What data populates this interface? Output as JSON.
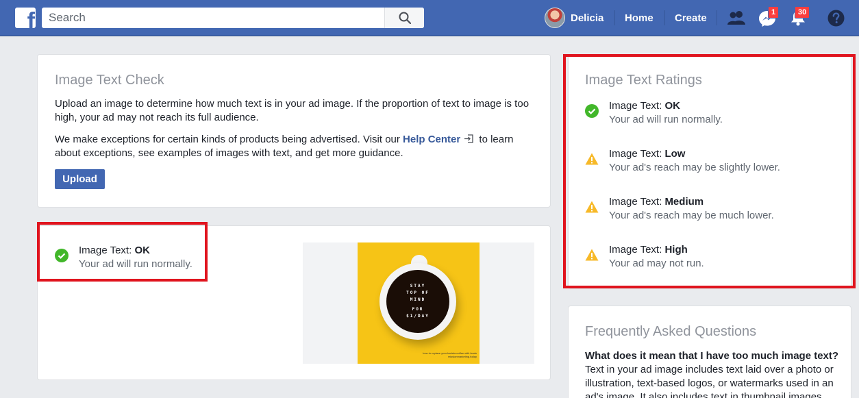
{
  "topbar": {
    "logo": "f",
    "search_placeholder": "Search",
    "user_name": "Delicia",
    "home": "Home",
    "create": "Create",
    "messenger_badge": "1",
    "notifications_badge": "30",
    "brand_color": "#4267b2"
  },
  "check_card": {
    "title": "Image Text Check",
    "para1": "Upload an image to determine how much text is in your ad image. If the proportion of text to image is too high, your ad may not reach its full audience.",
    "para2_before": "We make exceptions for certain kinds of products being advertised. Visit our ",
    "help_link": "Help Center",
    "para2_after": " to learn about exceptions, see examples of images with text, and get more guidance.",
    "upload_label": "Upload"
  },
  "result_card": {
    "label": "Image Text:",
    "value": "OK",
    "desc": "Your ad will run normally.",
    "image": {
      "lines": [
        "STAY",
        "TOP OF",
        "MIND",
        "FOR",
        "$1/DAY"
      ],
      "caption": "how to replace your barista coffee with leads missionmarketing.today"
    }
  },
  "ratings_card": {
    "title": "Image Text Ratings",
    "items": [
      {
        "label": "Image Text:",
        "level": "OK",
        "desc": "Your ad will run normally.",
        "icon": "check-icon"
      },
      {
        "label": "Image Text:",
        "level": "Low",
        "desc": "Your ad's reach may be slightly lower.",
        "icon": "warning-icon"
      },
      {
        "label": "Image Text:",
        "level": "Medium",
        "desc": "Your ad's reach may be much lower.",
        "icon": "warning-icon"
      },
      {
        "label": "Image Text:",
        "level": "High",
        "desc": "Your ad may not run.",
        "icon": "warning-icon"
      }
    ]
  },
  "faq_card": {
    "title": "Frequently Asked Questions",
    "question": "What does it mean that I have too much image text?",
    "answer": "Text in your ad image includes text laid over a photo or illustration, text-based logos, or watermarks used in an ad's image. It also includes text in thumbnail images"
  },
  "colors": {
    "highlight_red": "#e0141e",
    "ok_green": "#42b72a",
    "warning_yellow": "#f7b928"
  }
}
